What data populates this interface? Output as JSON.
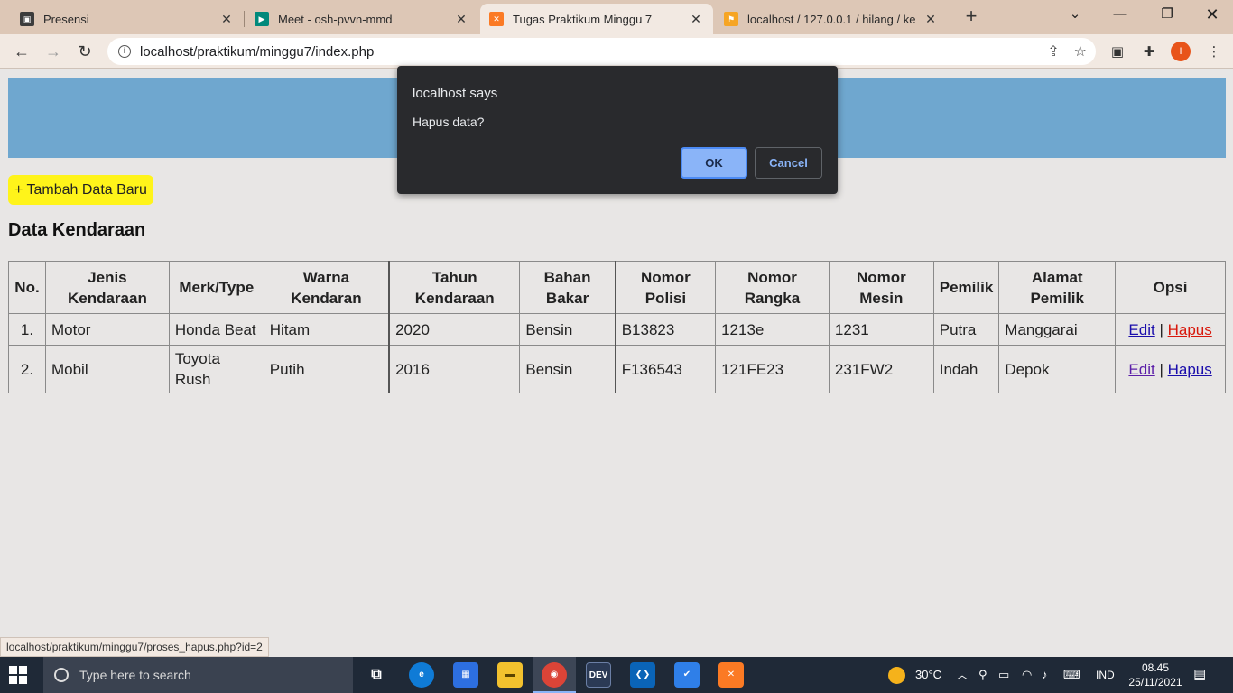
{
  "browser": {
    "tabs": [
      {
        "title": "Presensi",
        "close": "✕",
        "color": "#3c3c3c"
      },
      {
        "title": "Meet - osh-pvvn-mmd",
        "close": "✕",
        "color": "#00897b"
      },
      {
        "title": "Tugas Praktikum Minggu 7",
        "close": "✕",
        "color": "#fb7a24"
      },
      {
        "title": "localhost / 127.0.0.1 / hilang / ke",
        "close": "✕",
        "color": "#f6a524"
      }
    ],
    "new_tab": "+",
    "url": "localhost/praktikum/minggu7/index.php",
    "profile_initial": "I"
  },
  "page": {
    "add_button": "+ Tambah Data Baru",
    "heading": "Data Kendaraan",
    "table": {
      "headers": [
        "No.",
        "Jenis Kendaraan",
        "Merk/Type",
        "Warna Kendaran",
        "Tahun Kendaraan",
        "Bahan Bakar",
        "Nomor Polisi",
        "Nomor Rangka",
        "Nomor Mesin",
        "Pemilik",
        "Alamat Pemilik",
        "Opsi"
      ],
      "rows": [
        {
          "no": "1.",
          "jenis": "Motor",
          "merk": "Honda Beat",
          "warna": "Hitam",
          "tahun": "2020",
          "bahan": "Bensin",
          "polisi": "B13823",
          "rangka": "1213e",
          "mesin": "1231",
          "pemilik": "Putra",
          "alamat": "Manggarai",
          "edit": "Edit",
          "sep": "|",
          "hapus": "Hapus"
        },
        {
          "no": "2.",
          "jenis": "Mobil",
          "merk": "Toyota Rush",
          "warna": "Putih",
          "tahun": "2016",
          "bahan": "Bensin",
          "polisi": "F136543",
          "rangka": "121FE23",
          "mesin": "231FW2",
          "pemilik": "Indah",
          "alamat": "Depok",
          "edit": "Edit",
          "sep": "|",
          "hapus": "Hapus"
        }
      ]
    }
  },
  "dialog": {
    "title": "localhost says",
    "message": "Hapus data?",
    "ok_label": "OK",
    "cancel_label": "Cancel"
  },
  "status_url": "localhost/praktikum/minggu7/proses_hapus.php?id=2",
  "taskbar": {
    "search_placeholder": "Type here to search",
    "weather": "30°C",
    "language": "IND",
    "time": "08.45",
    "date": "25/11/2021"
  }
}
